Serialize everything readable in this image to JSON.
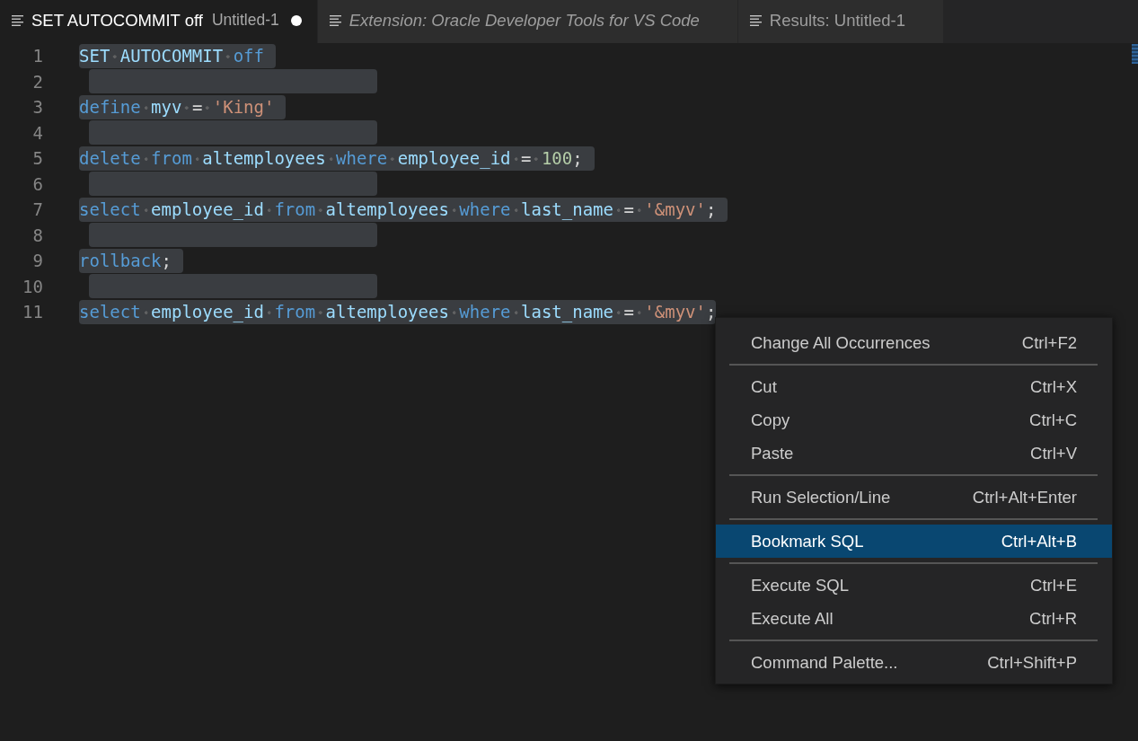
{
  "tabs": [
    {
      "label": "SET AUTOCOMMIT off",
      "description": "Untitled-1",
      "selected": true,
      "dirty": true,
      "preview": false
    },
    {
      "label": "Extension: Oracle Developer Tools for VS Code",
      "selected": false,
      "dirty": false,
      "preview": true
    },
    {
      "label": "Results: Untitled-1",
      "selected": false,
      "dirty": false,
      "preview": false
    }
  ],
  "editor": {
    "lines": [
      {
        "number": "1",
        "selected": true,
        "tokens": [
          {
            "text": "SET ",
            "kind": "identifier"
          },
          {
            "text": "AUTOCOMMIT ",
            "kind": "identifier"
          },
          {
            "text": "off",
            "kind": "keyword"
          }
        ]
      },
      {
        "number": "2",
        "selected": true
      },
      {
        "number": "3",
        "selected": true,
        "tokens": [
          {
            "text": "define ",
            "kind": "keyword"
          },
          {
            "text": "myv ",
            "kind": "identifier"
          },
          {
            "text": "= ",
            "kind": "operator"
          },
          {
            "text": "'King'",
            "kind": "string"
          }
        ]
      },
      {
        "number": "4",
        "selected": true
      },
      {
        "number": "5",
        "selected": true,
        "tokens": [
          {
            "text": "delete from ",
            "kind": "keyword"
          },
          {
            "text": "altemployees ",
            "kind": "identifier"
          },
          {
            "text": "where ",
            "kind": "keyword"
          },
          {
            "text": "employee_id ",
            "kind": "identifier"
          },
          {
            "text": "= ",
            "kind": "operator"
          },
          {
            "text": "100",
            "kind": "number"
          },
          {
            "text": ";",
            "kind": "operator"
          }
        ]
      },
      {
        "number": "6",
        "selected": true
      },
      {
        "number": "7",
        "selected": true,
        "tokens": [
          {
            "text": "select ",
            "kind": "keyword"
          },
          {
            "text": "employee_id ",
            "kind": "identifier"
          },
          {
            "text": "from ",
            "kind": "keyword"
          },
          {
            "text": "altemployees ",
            "kind": "identifier"
          },
          {
            "text": "where ",
            "kind": "keyword"
          },
          {
            "text": "last_name ",
            "kind": "identifier"
          },
          {
            "text": "= ",
            "kind": "operator"
          },
          {
            "text": "'&myv'",
            "kind": "string"
          },
          {
            "text": ";",
            "kind": "operator"
          }
        ]
      },
      {
        "number": "8",
        "selected": true
      },
      {
        "number": "9",
        "selected": true,
        "tokens": [
          {
            "text": "rollback",
            "kind": "keyword"
          },
          {
            "text": ";",
            "kind": "operator"
          }
        ]
      },
      {
        "number": "10",
        "selected": true
      },
      {
        "number": "11",
        "selected": true,
        "tokens": [
          {
            "text": "select ",
            "kind": "keyword"
          },
          {
            "text": "employee_id ",
            "kind": "identifier"
          },
          {
            "text": "from ",
            "kind": "keyword"
          },
          {
            "text": "altemployees ",
            "kind": "identifier"
          },
          {
            "text": "where ",
            "kind": "keyword"
          },
          {
            "text": "last_name ",
            "kind": "identifier"
          },
          {
            "text": "= ",
            "kind": "operator"
          },
          {
            "text": "'&myv'",
            "kind": "string"
          },
          {
            "text": ";",
            "kind": "operator"
          }
        ]
      }
    ]
  },
  "context_menu": {
    "groups": [
      [
        {
          "label": "Change All Occurrences",
          "shortcut": "Ctrl+F2",
          "selected": false
        }
      ],
      [
        {
          "label": "Cut",
          "shortcut": "Ctrl+X",
          "selected": false
        },
        {
          "label": "Copy",
          "shortcut": "Ctrl+C",
          "selected": false
        },
        {
          "label": "Paste",
          "shortcut": "Ctrl+V",
          "selected": false
        }
      ],
      [
        {
          "label": "Run Selection/Line",
          "shortcut": "Ctrl+Alt+Enter",
          "selected": false
        }
      ],
      [
        {
          "label": "Bookmark SQL",
          "shortcut": "Ctrl+Alt+B",
          "selected": true
        }
      ],
      [
        {
          "label": "Execute SQL",
          "shortcut": "Ctrl+E",
          "selected": false
        },
        {
          "label": "Execute All",
          "shortcut": "Ctrl+R",
          "selected": false
        }
      ],
      [
        {
          "label": "Command Palette...",
          "shortcut": "Ctrl+Shift+P",
          "selected": false
        }
      ]
    ]
  }
}
